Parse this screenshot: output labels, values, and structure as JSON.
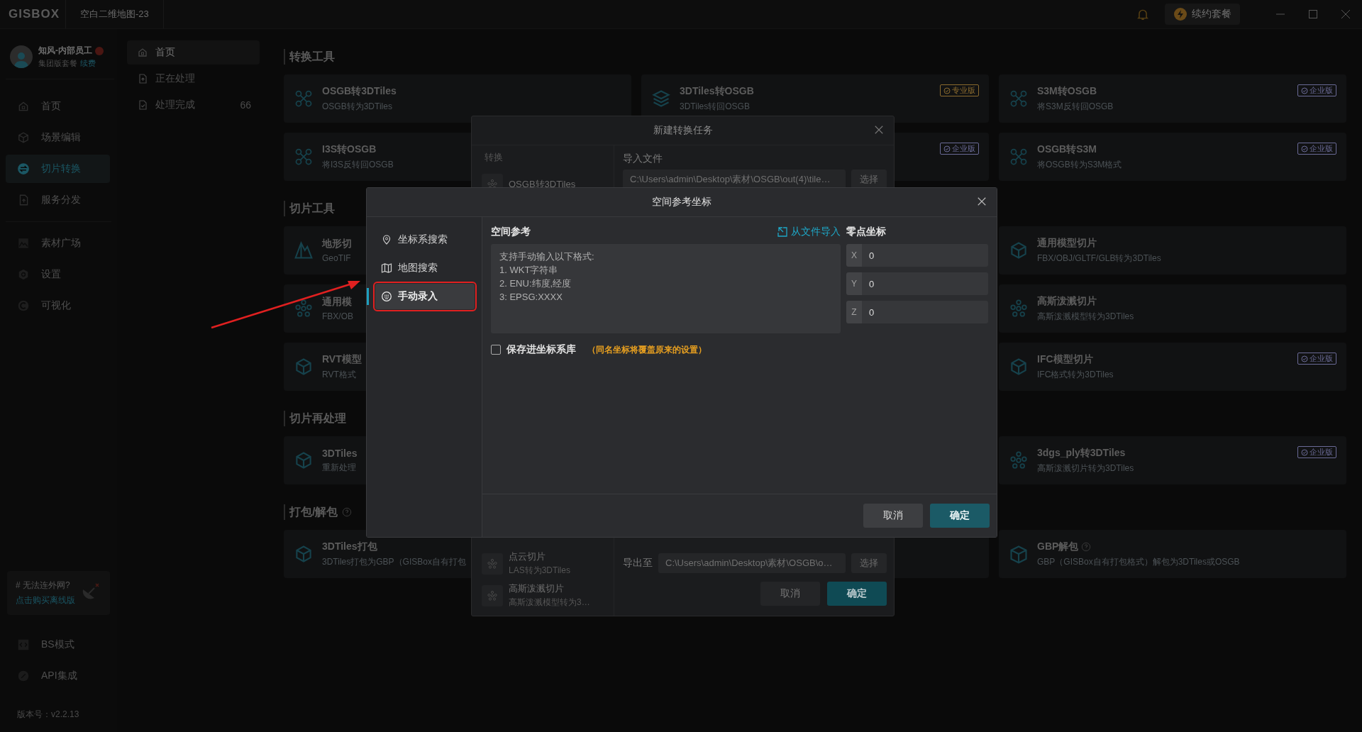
{
  "title_bar": {
    "logo": "GISBOX",
    "tab": "空白二维地图-23",
    "renew_button": "续约套餐"
  },
  "user": {
    "name": "知风-内部员工",
    "plan": "集团版套餐",
    "renew_link": "续费"
  },
  "sidebar": {
    "items": [
      {
        "label": "首页",
        "selected": false
      },
      {
        "label": "场景编辑",
        "selected": false
      },
      {
        "label": "切片转换",
        "selected": true
      },
      {
        "label": "服务分发",
        "selected": false
      },
      {
        "label": "素材广场",
        "selected": false
      },
      {
        "label": "设置",
        "selected": false
      },
      {
        "label": "可视化",
        "selected": false
      }
    ],
    "tip": {
      "title": "# 无法连外网?",
      "link": "点击购买离线版"
    },
    "bottom_items": [
      {
        "label": "BS模式"
      },
      {
        "label": "API集成"
      }
    ],
    "version": "版本号：v2.2.13"
  },
  "task_nav": {
    "items": [
      {
        "label": "首页",
        "selected": true
      },
      {
        "label": "正在处理",
        "selected": false
      },
      {
        "label": "处理完成",
        "selected": false,
        "count": "66"
      }
    ]
  },
  "sections": [
    {
      "title": "转换工具",
      "rows": [
        {
          "left": {
            "title": "OSGB转3DTiles",
            "subtitle": "OSGB转为3DTiles"
          },
          "middle": {
            "title": "3DTiles转OSGB",
            "subtitle": "3DTiles转回OSGB",
            "badge": {
              "label": "专业版",
              "color": "#8a6a2e"
            }
          },
          "right": {
            "title": "S3M转OSGB",
            "subtitle": "将S3M反转回OSGB",
            "badge": {
              "label": "企业版",
              "color": "#6a6a96"
            }
          }
        },
        {
          "left": {
            "title": "I3S转OSGB",
            "subtitle": "将I3S反转回OSGB"
          },
          "middle": {
            "badge": {
              "label": "企业版",
              "color": "#6a6a96"
            }
          },
          "right": {
            "title": "OSGB转S3M",
            "subtitle": "将OSGB转为S3M格式",
            "badge": {
              "label": "企业版",
              "color": "#6a6a96"
            }
          }
        }
      ]
    },
    {
      "title": "切片工具",
      "rows": [
        {
          "left": {
            "title": "地形切",
            "subtitle": "GeoTIF"
          },
          "right": {
            "title": "通用模型切片",
            "subtitle": "FBX/OBJ/GLTF/GLB转为3DTiles"
          }
        },
        {
          "left": {
            "title": "通用模",
            "subtitle": "FBX/OB"
          },
          "right": {
            "title": "高斯泼溅切片",
            "subtitle": "高斯泼溅模型转为3DTiles"
          }
        },
        {
          "left": {
            "title": "RVT模型",
            "subtitle": "RVT格式"
          },
          "right": {
            "title": "IFC模型切片",
            "subtitle": "IFC格式转为3DTiles",
            "badge": {
              "label": "企业版",
              "color": "#6a6a96"
            }
          }
        }
      ]
    },
    {
      "title": "切片再处理",
      "rows": [
        {
          "left": {
            "title": "3DTiles",
            "subtitle": "重新处理"
          },
          "right": {
            "title": "3dgs_ply转3DTiles",
            "subtitle": "高斯泼溅切片转为3DTiles",
            "badge": {
              "label": "企业版",
              "color": "#6a6a96"
            }
          }
        }
      ]
    },
    {
      "title": "打包/解包",
      "help": true,
      "rows": [
        {
          "left": {
            "title": "3DTiles打包",
            "subtitle": "3DTiles打包为GBP（GISBox自有打包"
          },
          "right": {
            "title": "GBP解包",
            "help": true,
            "subtitle": "GBP（GISBox自有打包格式）解包为3DTiles或OSGB"
          }
        }
      ]
    }
  ],
  "convert_dialog": {
    "title": "新建转换任务",
    "list_label": "转换",
    "top_items": [
      {
        "title": "OSGB转3DTiles"
      }
    ],
    "bottom_items": [
      {
        "title": "点云切片",
        "subtitle": "LAS转为3DTiles"
      },
      {
        "title": "高斯泼溅切片",
        "subtitle": "高斯泼溅模型转为3…"
      }
    ],
    "import_label": "导入文件",
    "import_path": "C:\\Users\\admin\\Desktop\\素材\\OSGB\\out(4)\\tile…",
    "import_select": "选择",
    "export_label": "导出至",
    "export_path": "C:\\Users\\admin\\Desktop\\素材\\OSGB\\o…",
    "export_select": "选择",
    "cancel": "取消",
    "confirm": "确定"
  },
  "srs_dialog": {
    "title": "空间参考坐标",
    "nav": [
      {
        "label": "坐标系搜索",
        "selected": false
      },
      {
        "label": "地图搜索",
        "selected": false
      },
      {
        "label": "手动录入",
        "selected": true
      }
    ],
    "srs_label": "空间参考",
    "import_link": "从文件导入",
    "srs_placeholder": "支持手动输入以下格式:\n1. WKT字符串\n2. ENU:纬度,经度\n3: EPSG:XXXX",
    "origin_label": "零点坐标",
    "coords": [
      {
        "axis": "X",
        "value": "0"
      },
      {
        "axis": "Y",
        "value": "0"
      },
      {
        "axis": "Z",
        "value": "0"
      }
    ],
    "save": {
      "label": "保存进坐标系库",
      "checked": false
    },
    "save_note": "（同名坐标将覆盖原来的设置）",
    "cancel": "取消",
    "confirm": "确定"
  }
}
